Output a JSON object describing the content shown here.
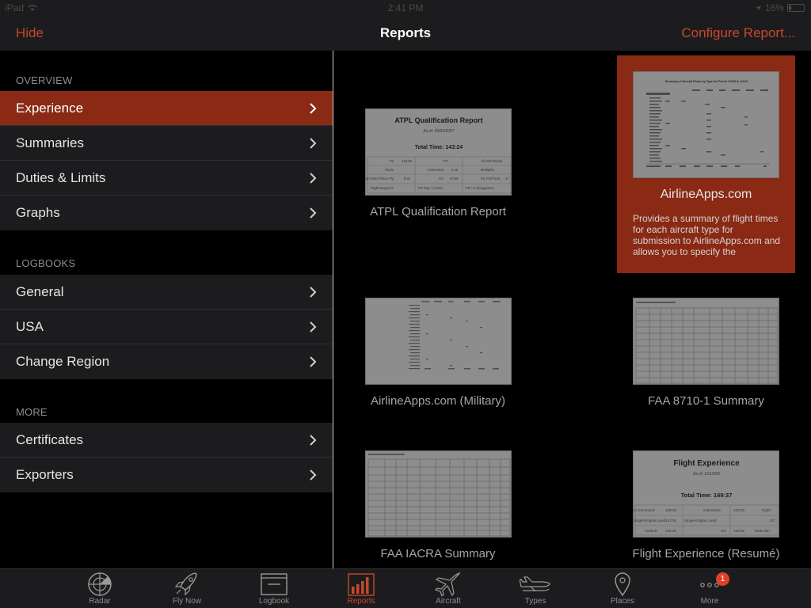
{
  "status_bar": {
    "device": "iPad",
    "time": "2:41 PM",
    "battery": "16%"
  },
  "nav": {
    "left_label": "Hide",
    "title": "Reports",
    "right_label": "Configure Report..."
  },
  "sidebar": {
    "sections": [
      {
        "header": "OVERVIEW",
        "items": [
          {
            "label": "Experience",
            "selected": true
          },
          {
            "label": "Summaries"
          },
          {
            "label": "Duties & Limits"
          },
          {
            "label": "Graphs"
          }
        ]
      },
      {
        "header": "LOGBOOKS",
        "items": [
          {
            "label": "General"
          },
          {
            "label": "USA"
          },
          {
            "label": "Change Region"
          }
        ]
      },
      {
        "header": "MORE",
        "items": [
          {
            "label": "Certificates"
          },
          {
            "label": "Exporters"
          }
        ]
      }
    ]
  },
  "reports": {
    "items": [
      {
        "title": "ATPL Qualification Report",
        "thumb": {
          "heading": "ATPL Qualification Report",
          "as_of": "As of: 30/04/2007",
          "total": "Total Time: 143:24",
          "rows": [
            [
              "P1:",
              "143:09",
              "P2:",
              "All (Solo/Dual):"
            ],
            [
              "P1u/s:",
              "",
              "Instrument:",
              "2:18",
              "Multipilot:"
            ],
            [
              "ght MSC/Place Fly:",
              "8:41",
              "XC:",
              "47:59",
              "XC P1/P1u/s:",
              "47"
            ],
            [
              "Flight Engineer:",
              "",
              "PR Eng / S (NR):",
              "",
              "PR / S (Singapore):"
            ]
          ]
        }
      },
      {
        "title": "AirlineApps.com",
        "selected": true,
        "description": "Provides a summary of flight times for each aircraft type for submission to AirlineApps.com and allows you to specify the",
        "thumb": {
          "heading": "Summary of Aircraft Flown by Type for Period 1/1/08 to 1/1/10"
        }
      },
      {
        "title": "AirlineApps.com (Military)"
      },
      {
        "title": "FAA 8710-1 Summary"
      },
      {
        "title": "FAA IACRA Summary"
      },
      {
        "title": "Flight Experience (Resumé)",
        "thumb": {
          "heading": "Flight Experience",
          "as_of": "As of: 12/19/09",
          "total": "Total Time: 169:37",
          "rows": [
            [
              "In Command:",
              "129:45",
              "Instrument:",
              "163:20",
              "Night:"
            ],
            [
              "Single-Engine Land:",
              "142:00",
              "Single-Engine Land:",
              "",
              "XC:"
            ],
            [
              "Turbine:",
              "142:00",
              "",
              "Jet:",
              "142:00",
              "Turbo-fan:"
            ]
          ]
        }
      }
    ]
  },
  "tab_bar": {
    "tabs": [
      {
        "label": "Radar",
        "icon": "radar-icon"
      },
      {
        "label": "Fly Now",
        "icon": "rocket-icon"
      },
      {
        "label": "Logbook",
        "icon": "logbook-icon"
      },
      {
        "label": "Reports",
        "icon": "reports-icon",
        "active": true
      },
      {
        "label": "Aircraft",
        "icon": "aircraft-icon"
      },
      {
        "label": "Types",
        "icon": "types-icon"
      },
      {
        "label": "Places",
        "icon": "places-icon"
      },
      {
        "label": "More",
        "icon": "more-icon",
        "badge": "1"
      }
    ]
  },
  "colors": {
    "accent": "#c8472d",
    "selected_bg": "#8a2a15",
    "cell_bg": "#1c1c1e"
  }
}
